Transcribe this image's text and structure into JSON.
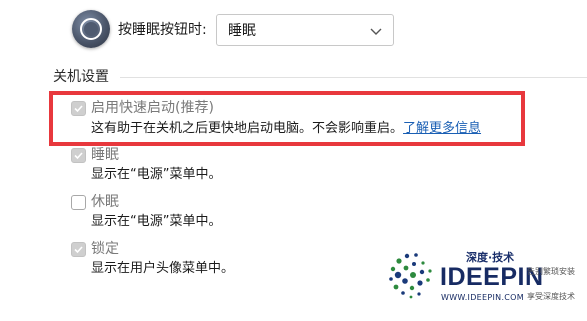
{
  "sleep_button": {
    "label": "按睡眠按钮时:",
    "selected": "睡眠",
    "icon": "sleep-power-icon"
  },
  "shutdown_settings": {
    "title": "关机设置",
    "options": [
      {
        "title": "启用快速启动(推荐)",
        "description": "这有助于在关机之后更快地启动电脑。不会影响重启。",
        "link": "了解更多信息",
        "checked": true,
        "highlighted": true
      },
      {
        "title": "睡眠",
        "description": "显示在“电源”菜单中。",
        "checked": true
      },
      {
        "title": "休眠",
        "description": "显示在“电源”菜单中。",
        "checked": false
      },
      {
        "title": "锁定",
        "description": "显示在用户头像菜单中。",
        "checked": true
      }
    ]
  },
  "highlight_color": "#e8383d",
  "link_color": "#1a5fb4",
  "watermark": {
    "tagline_top": "深度·技术",
    "brand": "IDEEPIN",
    "url": "WWW.IDEEPIN.COM",
    "slogan_1": "告别繁琐安装",
    "slogan_2": "享受深度技术"
  }
}
